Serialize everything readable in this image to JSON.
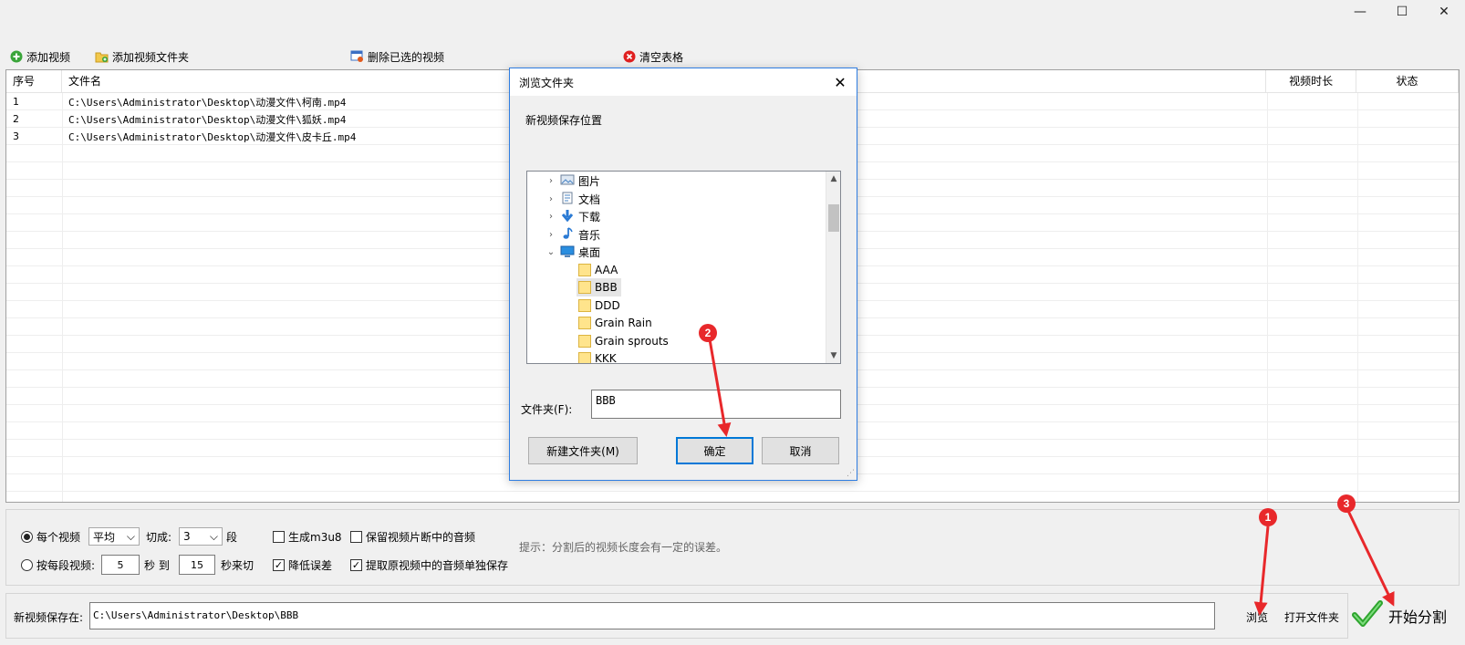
{
  "window": {
    "min_icon": "—",
    "max_icon": "☐",
    "close_icon": "✕"
  },
  "toolbar": {
    "add_video": "添加视频",
    "add_folder": "添加视频文件夹",
    "delete_selected": "删除已选的视频",
    "clear_table": "清空表格"
  },
  "table": {
    "headers": {
      "index": "序号",
      "filename": "文件名",
      "duration": "视频时长",
      "status": "状态"
    },
    "rows": [
      {
        "index": "1",
        "filename": "C:\\Users\\Administrator\\Desktop\\动漫文件\\柯南.mp4"
      },
      {
        "index": "2",
        "filename": "C:\\Users\\Administrator\\Desktop\\动漫文件\\狐妖.mp4"
      },
      {
        "index": "3",
        "filename": "C:\\Users\\Administrator\\Desktop\\动漫文件\\皮卡丘.mp4"
      }
    ]
  },
  "options": {
    "each_video": "每个视频",
    "mode_value": "平均",
    "cut_into": "切成:",
    "segments_value": "3",
    "segments_unit": "段",
    "per_segment": "按每段视频:",
    "sec_from": "5",
    "sec_label": "秒 到",
    "sec_to": "15",
    "sec_cut": "秒来切",
    "gen_m3u8": "生成m3u8",
    "reduce_error": "降低误差",
    "keep_audio": "保留视频片断中的音频",
    "extract_audio": "提取原视频中的音频单独保存",
    "hint": "提示：分割后的视频长度会有一定的误差。"
  },
  "save": {
    "label": "新视频保存在:",
    "path": "C:\\Users\\Administrator\\Desktop\\BBB",
    "browse": "浏览",
    "open_folder": "打开文件夹",
    "start": "开始分割"
  },
  "dialog": {
    "title": "浏览文件夹",
    "description": "新视频保存位置",
    "tree": {
      "pictures": "图片",
      "documents": "文档",
      "downloads": "下载",
      "music": "音乐",
      "desktop": "桌面",
      "folders": [
        "AAA",
        "BBB",
        "DDD",
        "Grain Rain",
        "Grain sprouts",
        "KKK"
      ]
    },
    "folder_label": "文件夹(F):",
    "folder_value": "BBB",
    "new_folder": "新建文件夹(M)",
    "ok": "确定",
    "cancel": "取消"
  },
  "annotations": {
    "m1": "1",
    "m2": "2",
    "m3": "3"
  },
  "colors": {
    "marker": "#e8282b",
    "dialog_border": "#2f7de1",
    "ok_border": "#0078d7",
    "start_check": "#2ea52e"
  }
}
